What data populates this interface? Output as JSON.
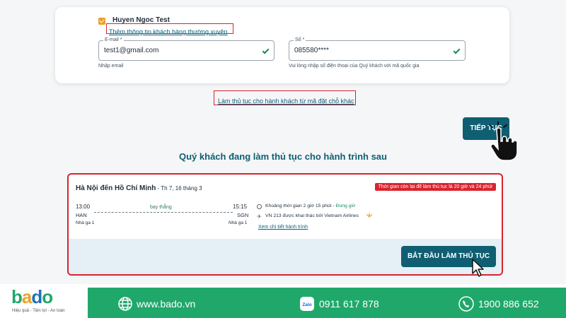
{
  "passenger": {
    "name": "Huyen Ngoc Test",
    "add_frequent_link": "Thêm thông tin khách hàng thường xuyên",
    "email_label": "E-mail *",
    "email_value": "test1@gmail.com",
    "email_hint": "Nhập email",
    "phone_label": "Số *",
    "phone_value": "085580****",
    "phone_hint": "Vui lòng nhập số điện thoại của Quý khách với mã quốc gia"
  },
  "other_booking_link": "Làm thủ tục cho hành khách từ mã đặt chỗ khác",
  "continue_button": "TIẾP TỤC",
  "section_title": "Quý khách đang làm thủ tục cho hành trình sau",
  "itinerary": {
    "route": "Hà Nội đến Hồ Chí Minh",
    "date": " - Th 7, 16 tháng 3",
    "time_remaining": "Thời gian còn lại để làm thủ tục là 20 giờ và 24 phút",
    "depart_time": "13:00",
    "arrive_time": "15:15",
    "flight_type": "bay thẳng",
    "depart_code": "HAN",
    "arrive_code": "SGN",
    "depart_terminal": "Nhà ga 1",
    "arrive_terminal": "Nhà ga 1",
    "duration": "Khoảng thời gian 2 giờ 15 phút",
    "status_sep": " - ",
    "status": "Đúng giờ",
    "operator": "VN 213 được khai thác bởi Vietnam Airlines",
    "details_link": "Xem chi tiết hành trình",
    "start_button": "BẮT ĐẦU LÀM THỦ TỤC"
  },
  "footer": {
    "brand_letters": [
      "b",
      "a",
      "d",
      "o"
    ],
    "tagline": "Hiệu quả - Tiện lợi - An toàn",
    "website": "www.bado.vn",
    "zalo_phone": "0911 617 878",
    "hotline": "1900 886 652",
    "zalo_label": "Zalo",
    "colors": {
      "green": "#20a86b",
      "teal": "#0f5e72",
      "red": "#d9232d"
    }
  }
}
